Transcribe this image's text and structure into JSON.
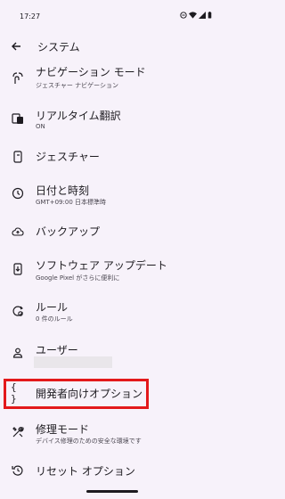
{
  "status_bar": {
    "time": "17:27"
  },
  "header": {
    "back_icon": "arrow-back-icon",
    "title": "システム"
  },
  "items": [
    {
      "icon": "gesture-nav-icon",
      "label": "ナビゲーション モード",
      "sub": "ジェスチャー ナビゲーション"
    },
    {
      "icon": "live-translate-icon",
      "label": "リアルタイム翻訳",
      "sub": "ON"
    },
    {
      "icon": "phone-gesture-icon",
      "label": "ジェスチャー",
      "sub": ""
    },
    {
      "icon": "clock-icon",
      "label": "日付と時刻",
      "sub": "GMT+09:00 日本標準時"
    },
    {
      "icon": "cloud-upload-icon",
      "label": "バックアップ",
      "sub": ""
    },
    {
      "icon": "system-update-icon",
      "label": "ソフトウェア アップデート",
      "sub": "Google Pixel がさらに便利に"
    },
    {
      "icon": "rules-icon",
      "label": "ルール",
      "sub": "0 件のルール"
    },
    {
      "icon": "person-icon",
      "label": "ユーザー",
      "sub": ""
    },
    {
      "icon": "braces-icon",
      "label": "開発者向けオプション",
      "sub": ""
    },
    {
      "icon": "tools-icon",
      "label": "修理モード",
      "sub": "デバイス修理のための安全な環境です"
    },
    {
      "icon": "reset-icon",
      "label": "リセット オプション",
      "sub": ""
    }
  ],
  "colors": {
    "background": "#f7f2fa",
    "highlight": "#e3191b",
    "text": "#1d1b20"
  }
}
